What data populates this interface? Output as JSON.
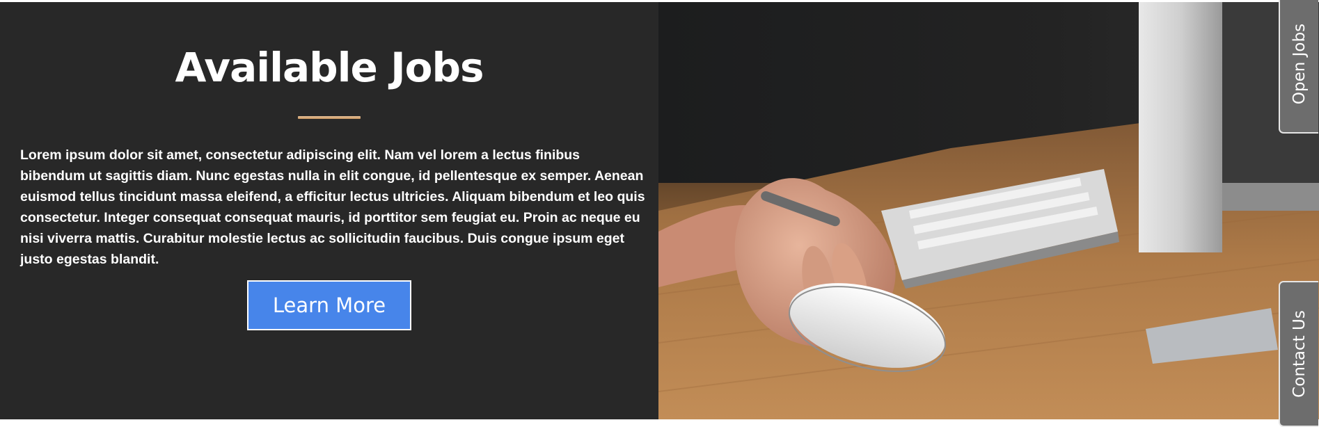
{
  "hero": {
    "title": "Available Jobs",
    "body": "Lorem ipsum dolor sit amet, consectetur adipiscing elit. Nam vel lorem a lectus finibus bibendum ut sagittis diam. Nunc egestas nulla in elit congue, id pellentesque ex semper. Aenean euismod tellus tincidunt massa eleifend, a efficitur lectus ultricies. Aliquam bibendum et leo quis consectetur. Integer consequat consequat mauris, id porttitor sem feugiat eu. Proin ac neque eu nisi viverra mattis. Curabitur molestie lectus ac sollicitudin faucibus. Duis congue ipsum eget justo egestas blandit.",
    "button_label": "Learn More"
  },
  "side_tabs": {
    "open_jobs": "Open Jobs",
    "contact_us": "Contact Us"
  },
  "colors": {
    "panel_bg": "#282828",
    "button_bg": "#4785ea",
    "divider": "#d8a873",
    "tab_bg": "#6d6d6d"
  }
}
